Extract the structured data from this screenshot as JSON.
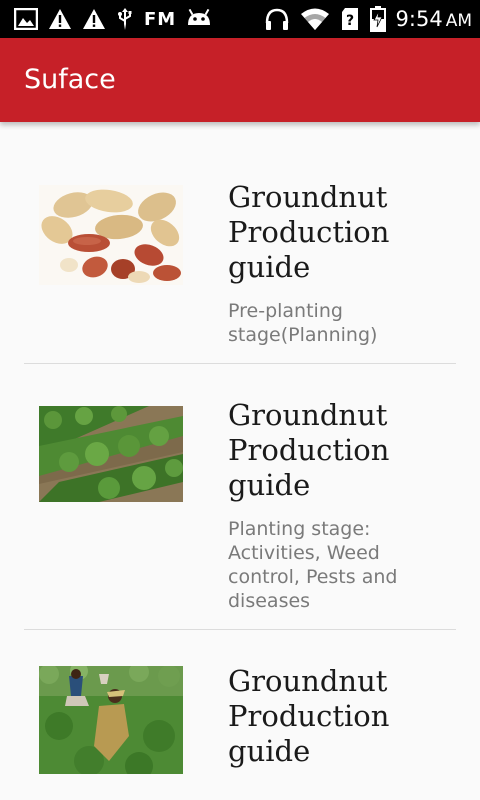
{
  "status_bar": {
    "icons_left": [
      "image-icon",
      "warning-icon",
      "warning-icon",
      "usb-icon",
      "fm-radio",
      "android-icon"
    ],
    "fm_label": "FM",
    "icons_right": [
      "headphones-icon",
      "wifi-icon",
      "no-sim-icon",
      "battery-charging-icon"
    ],
    "time": "9:54",
    "ampm": "AM"
  },
  "app_bar": {
    "title": "Suface",
    "color": "#c62028"
  },
  "items": [
    {
      "title_line1": "Groundnut",
      "title_line2": "Production",
      "title_line3": "guide",
      "subtitle": "Pre-planting stage(Planning)",
      "image": "groundnuts-photo"
    },
    {
      "title_line1": "Groundnut",
      "title_line2": "Production",
      "title_line3": "guide",
      "subtitle": "Planting stage: Activities, Weed control, Pests and diseases",
      "image": "groundnut-field-photo"
    },
    {
      "title_line1": "Groundnut",
      "title_line2": "Production",
      "title_line3": "guide",
      "subtitle": "",
      "image": "harvest-field-photo"
    }
  ]
}
